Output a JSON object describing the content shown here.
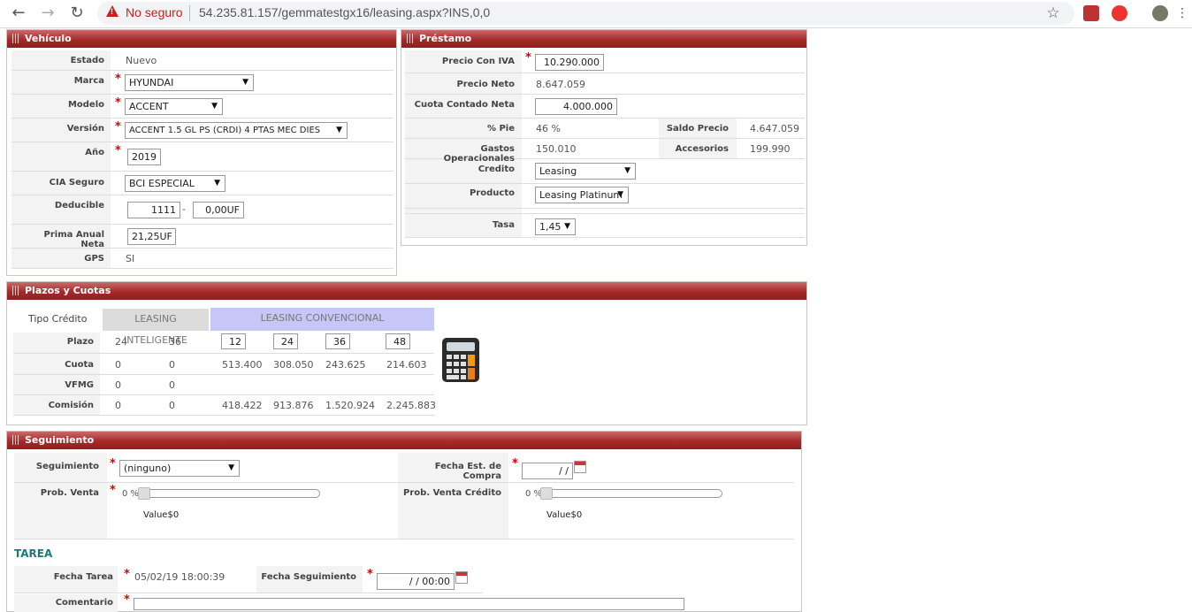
{
  "browser": {
    "security_label": "No seguro",
    "url": "54.235.81.157/gemmatestgx16/leasing.aspx?INS,0,0"
  },
  "vehiculo": {
    "title": "Vehículo",
    "estado_label": "Estado",
    "estado_value": "Nuevo",
    "marca_label": "Marca",
    "marca_value": "HYUNDAI",
    "modelo_label": "Modelo",
    "modelo_value": "ACCENT",
    "version_label": "Versión",
    "version_value": "ACCENT 1.5 GL PS (CRDI) 4 PTAS MEC DIES",
    "anio_label": "Año",
    "anio_value": "2019",
    "cia_label": "CIA Seguro",
    "cia_value": "BCI ESPECIAL",
    "deducible_label": "Deducible",
    "deducible_value1": "1111",
    "deducible_sep": "-",
    "deducible_value2": "0,00UF",
    "prima_label": "Prima Anual Neta",
    "prima_value": "21,25UF",
    "gps_label": "GPS",
    "gps_value": "SI"
  },
  "prestamo": {
    "title": "Préstamo",
    "precio_iva_label": "Precio Con IVA",
    "precio_iva_value": "10.290.000",
    "precio_neto_label": "Precio Neto",
    "precio_neto_value": "8.647.059",
    "cuota_contado_label": "Cuota Contado Neta",
    "cuota_contado_value": "4.000.000",
    "pie_label": "% Pie",
    "pie_value": "46 %",
    "saldo_label": "Saldo Precio",
    "saldo_value": "4.647.059",
    "gastos_label": "Gastos Operacionales",
    "gastos_value": "150.010",
    "accesorios_label": "Accesorios",
    "accesorios_value": "199.990",
    "credito_label": "Credito",
    "credito_value": "Leasing",
    "producto_label": "Producto",
    "producto_value": "Leasing Platinum",
    "tasa_label": "Tasa",
    "tasa_value": "1,45"
  },
  "plazos": {
    "title": "Plazos y Cuotas",
    "tipo_credito_label": "Tipo Crédito",
    "leasing_inteligente": "LEASING INTELIGENTE",
    "leasing_convencional": "LEASING CONVENCIONAL",
    "row_labels": [
      "Plazo",
      "Cuota",
      "VFMG",
      "Comisión"
    ],
    "plazo": [
      "24",
      "36",
      "12",
      "24",
      "36",
      "48"
    ],
    "cuota": [
      "0",
      "0",
      "513.400",
      "308.050",
      "243.625",
      "214.603"
    ],
    "vfmg": [
      "0",
      "0"
    ],
    "comision": [
      "0",
      "0",
      "418.422",
      "913.876",
      "1.520.924",
      "2.245.883"
    ]
  },
  "seguimiento": {
    "title": "Seguimiento",
    "seguimiento_label": "Seguimiento",
    "seguimiento_value": "(ninguno)",
    "fecha_compra_label": "Fecha Est. de Compra",
    "fecha_compra_value": "/ /",
    "prob_venta_label": "Prob. Venta",
    "prob_venta_pct": "0 %",
    "prob_venta_value": "Value$0",
    "prob_credito_label": "Prob. Venta Crédito",
    "prob_credito_pct": "0 %",
    "prob_credito_value": "Value$0",
    "tarea_heading": "TAREA",
    "fecha_tarea_label": "Fecha Tarea",
    "fecha_tarea_value": "05/02/19 18:00:39",
    "fecha_seg_label": "Fecha Seguimiento",
    "fecha_seg_value": "/ /  00:00",
    "comentario_label": "Comentario"
  }
}
